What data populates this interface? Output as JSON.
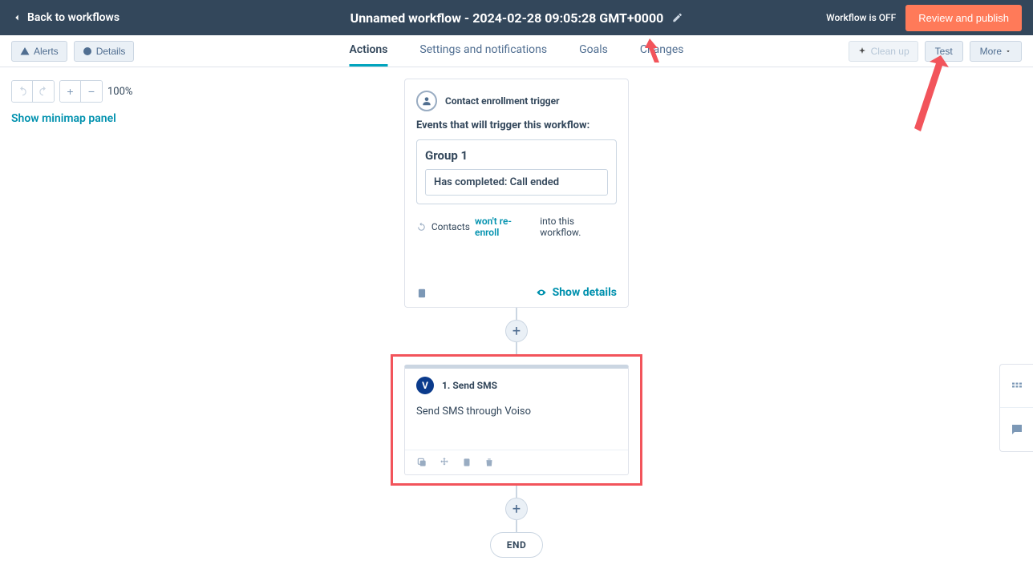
{
  "header": {
    "back": "Back to workflows",
    "title": "Unnamed workflow - 2024-02-28 09:05:28 GMT+0000",
    "status": "Workflow is OFF",
    "publish": "Review and publish"
  },
  "toolbar": {
    "alerts": "Alerts",
    "details": "Details",
    "cleanup": "Clean up",
    "test": "Test",
    "more": "More"
  },
  "tabs": {
    "actions": "Actions",
    "settings": "Settings and notifications",
    "goals": "Goals",
    "changes": "Changes"
  },
  "canvas_controls": {
    "zoom": "100%",
    "minimap": "Show minimap panel"
  },
  "trigger_card": {
    "title": "Contact enrollment trigger",
    "events_label": "Events that will trigger this workflow:",
    "group": "Group 1",
    "rule": "Has completed: Call ended",
    "reenroll_pre": "Contacts ",
    "reenroll_link": "won't re-enroll",
    "reenroll_post": " into this workflow.",
    "show_details": "Show details"
  },
  "action_card": {
    "badge": "V",
    "title": "1. Send SMS",
    "desc": "Send SMS through Voiso"
  },
  "end": "END"
}
